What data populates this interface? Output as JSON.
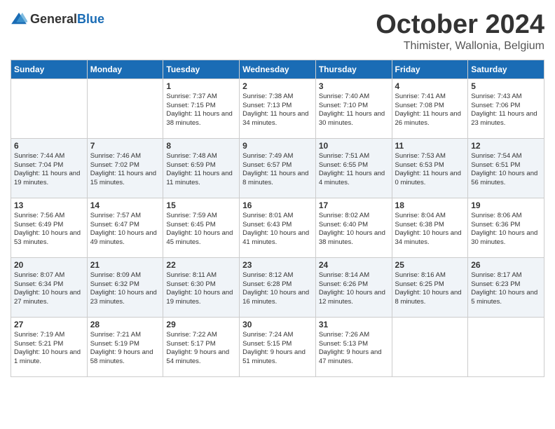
{
  "header": {
    "logo": {
      "general": "General",
      "blue": "Blue"
    },
    "title": "October 2024",
    "subtitle": "Thimister, Wallonia, Belgium"
  },
  "calendar": {
    "days_of_week": [
      "Sunday",
      "Monday",
      "Tuesday",
      "Wednesday",
      "Thursday",
      "Friday",
      "Saturday"
    ],
    "weeks": [
      [
        {
          "day": "",
          "info": ""
        },
        {
          "day": "",
          "info": ""
        },
        {
          "day": "1",
          "info": "Sunrise: 7:37 AM\nSunset: 7:15 PM\nDaylight: 11 hours and 38 minutes."
        },
        {
          "day": "2",
          "info": "Sunrise: 7:38 AM\nSunset: 7:13 PM\nDaylight: 11 hours and 34 minutes."
        },
        {
          "day": "3",
          "info": "Sunrise: 7:40 AM\nSunset: 7:10 PM\nDaylight: 11 hours and 30 minutes."
        },
        {
          "day": "4",
          "info": "Sunrise: 7:41 AM\nSunset: 7:08 PM\nDaylight: 11 hours and 26 minutes."
        },
        {
          "day": "5",
          "info": "Sunrise: 7:43 AM\nSunset: 7:06 PM\nDaylight: 11 hours and 23 minutes."
        }
      ],
      [
        {
          "day": "6",
          "info": "Sunrise: 7:44 AM\nSunset: 7:04 PM\nDaylight: 11 hours and 19 minutes."
        },
        {
          "day": "7",
          "info": "Sunrise: 7:46 AM\nSunset: 7:02 PM\nDaylight: 11 hours and 15 minutes."
        },
        {
          "day": "8",
          "info": "Sunrise: 7:48 AM\nSunset: 6:59 PM\nDaylight: 11 hours and 11 minutes."
        },
        {
          "day": "9",
          "info": "Sunrise: 7:49 AM\nSunset: 6:57 PM\nDaylight: 11 hours and 8 minutes."
        },
        {
          "day": "10",
          "info": "Sunrise: 7:51 AM\nSunset: 6:55 PM\nDaylight: 11 hours and 4 minutes."
        },
        {
          "day": "11",
          "info": "Sunrise: 7:53 AM\nSunset: 6:53 PM\nDaylight: 11 hours and 0 minutes."
        },
        {
          "day": "12",
          "info": "Sunrise: 7:54 AM\nSunset: 6:51 PM\nDaylight: 10 hours and 56 minutes."
        }
      ],
      [
        {
          "day": "13",
          "info": "Sunrise: 7:56 AM\nSunset: 6:49 PM\nDaylight: 10 hours and 53 minutes."
        },
        {
          "day": "14",
          "info": "Sunrise: 7:57 AM\nSunset: 6:47 PM\nDaylight: 10 hours and 49 minutes."
        },
        {
          "day": "15",
          "info": "Sunrise: 7:59 AM\nSunset: 6:45 PM\nDaylight: 10 hours and 45 minutes."
        },
        {
          "day": "16",
          "info": "Sunrise: 8:01 AM\nSunset: 6:43 PM\nDaylight: 10 hours and 41 minutes."
        },
        {
          "day": "17",
          "info": "Sunrise: 8:02 AM\nSunset: 6:40 PM\nDaylight: 10 hours and 38 minutes."
        },
        {
          "day": "18",
          "info": "Sunrise: 8:04 AM\nSunset: 6:38 PM\nDaylight: 10 hours and 34 minutes."
        },
        {
          "day": "19",
          "info": "Sunrise: 8:06 AM\nSunset: 6:36 PM\nDaylight: 10 hours and 30 minutes."
        }
      ],
      [
        {
          "day": "20",
          "info": "Sunrise: 8:07 AM\nSunset: 6:34 PM\nDaylight: 10 hours and 27 minutes."
        },
        {
          "day": "21",
          "info": "Sunrise: 8:09 AM\nSunset: 6:32 PM\nDaylight: 10 hours and 23 minutes."
        },
        {
          "day": "22",
          "info": "Sunrise: 8:11 AM\nSunset: 6:30 PM\nDaylight: 10 hours and 19 minutes."
        },
        {
          "day": "23",
          "info": "Sunrise: 8:12 AM\nSunset: 6:28 PM\nDaylight: 10 hours and 16 minutes."
        },
        {
          "day": "24",
          "info": "Sunrise: 8:14 AM\nSunset: 6:26 PM\nDaylight: 10 hours and 12 minutes."
        },
        {
          "day": "25",
          "info": "Sunrise: 8:16 AM\nSunset: 6:25 PM\nDaylight: 10 hours and 8 minutes."
        },
        {
          "day": "26",
          "info": "Sunrise: 8:17 AM\nSunset: 6:23 PM\nDaylight: 10 hours and 5 minutes."
        }
      ],
      [
        {
          "day": "27",
          "info": "Sunrise: 7:19 AM\nSunset: 5:21 PM\nDaylight: 10 hours and 1 minute."
        },
        {
          "day": "28",
          "info": "Sunrise: 7:21 AM\nSunset: 5:19 PM\nDaylight: 9 hours and 58 minutes."
        },
        {
          "day": "29",
          "info": "Sunrise: 7:22 AM\nSunset: 5:17 PM\nDaylight: 9 hours and 54 minutes."
        },
        {
          "day": "30",
          "info": "Sunrise: 7:24 AM\nSunset: 5:15 PM\nDaylight: 9 hours and 51 minutes."
        },
        {
          "day": "31",
          "info": "Sunrise: 7:26 AM\nSunset: 5:13 PM\nDaylight: 9 hours and 47 minutes."
        },
        {
          "day": "",
          "info": ""
        },
        {
          "day": "",
          "info": ""
        }
      ]
    ]
  }
}
